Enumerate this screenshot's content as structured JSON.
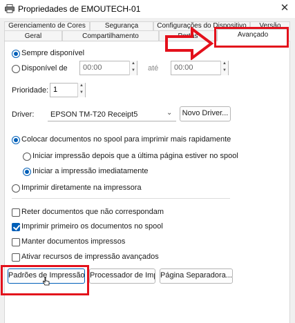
{
  "window": {
    "title": "Propriedades de EMOUTECH-01",
    "close_glyph": "✕",
    "app_icon": "printer-icon"
  },
  "tabs_back": [
    "Gerenciamento de Cores",
    "Segurança",
    "Configurações do Dispositivo",
    "Versão"
  ],
  "tabs_front": [
    "Geral",
    "Compartilhamento",
    "Portas",
    "Avançado"
  ],
  "availability": {
    "always_label": "Sempre disponível",
    "available_label": "Disponível de",
    "from_value": "00:00",
    "to_label": "até",
    "to_value": "00:00",
    "selected": "always"
  },
  "priority": {
    "label": "Prioridade:",
    "value": "1"
  },
  "driver": {
    "label": "Driver:",
    "value": "EPSON TM-T20 Receipt5",
    "new_driver_label": "Novo Driver..."
  },
  "spool": {
    "spool_label": "Colocar documentos no spool para imprimir mais rapidamente",
    "start_after_last_label": "Iniciar impressão depois que a última página estiver no spool",
    "start_immediately_label": "Iniciar a impressão imediatamente",
    "direct_label": "Imprimir diretamente na impressora"
  },
  "options": {
    "hold_mismatched_label": "Reter documentos que não correspondam",
    "hold_mismatched": false,
    "print_spooled_first_label": "Imprimir primeiro os documentos no spool",
    "print_spooled_first": true,
    "keep_printed_label": "Manter documentos impressos",
    "keep_printed": false,
    "advanced_features_label": "Ativar recursos de impressão avançados",
    "advanced_features": false
  },
  "buttons": {
    "print_defaults": "Padrões de Impressão...",
    "print_processor": "Processador de Imp...",
    "separator_page": "Página Separadora..."
  },
  "annotation_color": "#e3101b",
  "accent_color": "#005fb8"
}
